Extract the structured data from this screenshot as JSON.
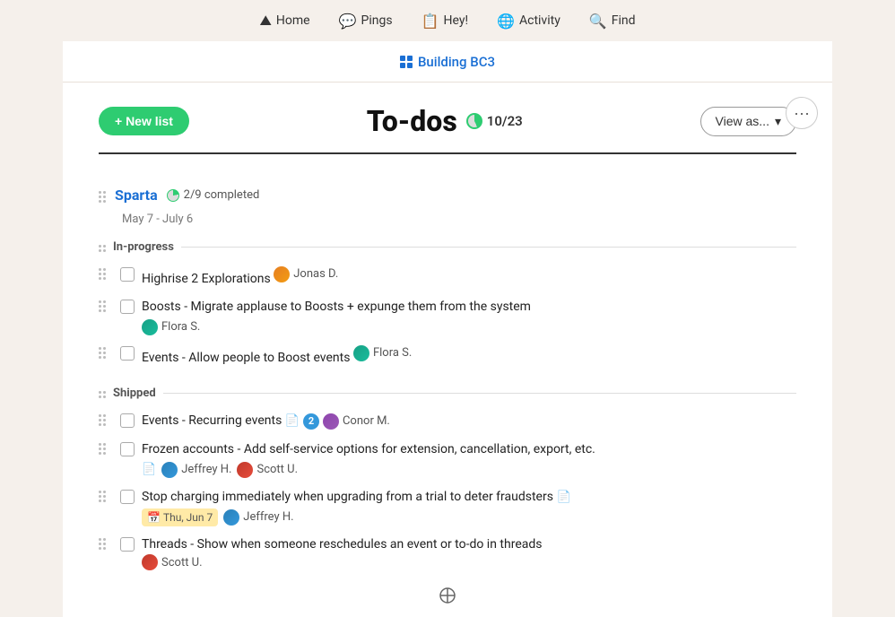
{
  "nav": {
    "items": [
      {
        "id": "home",
        "label": "Home",
        "icon": "⛰"
      },
      {
        "id": "pings",
        "label": "Pings",
        "icon": "💬"
      },
      {
        "id": "hey",
        "label": "Hey!",
        "icon": "📋"
      },
      {
        "id": "activity",
        "label": "Activity",
        "icon": "🌐"
      },
      {
        "id": "find",
        "label": "Find",
        "icon": "🔍"
      }
    ]
  },
  "breadcrumb": {
    "label": "Building BC3",
    "icon": "grid"
  },
  "page": {
    "new_list_label": "+ New list",
    "title": "To-dos",
    "progress_label": "10/23",
    "view_as_label": "View as...",
    "more_icon": "···"
  },
  "list": {
    "title": "Sparta",
    "progress": "2/9 completed",
    "date_range": "May 7 - July 6",
    "sections": [
      {
        "id": "in-progress",
        "label": "In-progress",
        "items": [
          {
            "id": 1,
            "text": "Highrise 2 Explorations",
            "assignee": "Jonas D.",
            "avatar_class": "avatar-jonas",
            "has_doc": false,
            "badge": null,
            "date": null,
            "second_assignee": null
          },
          {
            "id": 2,
            "text": "Boosts - Migrate applause to Boosts + expunge them from the system",
            "assignee": "Flora S.",
            "avatar_class": "avatar-flora",
            "has_doc": false,
            "badge": null,
            "date": null,
            "second_assignee": null
          },
          {
            "id": 3,
            "text": "Events - Allow people to Boost events",
            "assignee": "Flora S.",
            "avatar_class": "avatar-flora",
            "has_doc": false,
            "badge": null,
            "date": null,
            "second_assignee": null
          }
        ]
      },
      {
        "id": "shipped",
        "label": "Shipped",
        "items": [
          {
            "id": 4,
            "text": "Events - Recurring events",
            "assignee": "Conor M.",
            "avatar_class": "avatar-conor",
            "has_doc": true,
            "badge": "2",
            "date": null,
            "second_assignee": null
          },
          {
            "id": 5,
            "text": "Frozen accounts - Add self-service options for extension, cancellation, export, etc.",
            "assignee": "Jeffrey H.",
            "avatar_class": "avatar-jeffrey",
            "has_doc": true,
            "badge": null,
            "date": null,
            "second_assignee": "Scott U.",
            "second_avatar_class": "avatar-scott"
          },
          {
            "id": 6,
            "text": "Stop charging immediately when upgrading from a trial to deter fraudsters",
            "assignee": "Jeffrey H.",
            "avatar_class": "avatar-jeffrey",
            "has_doc": true,
            "badge": null,
            "date": "Thu, Jun 7",
            "second_assignee": null
          },
          {
            "id": 7,
            "text": "Threads - Show when someone reschedules an event or to-do in threads",
            "assignee": "Scott U.",
            "avatar_class": "avatar-scott",
            "has_doc": false,
            "badge": null,
            "date": null,
            "second_assignee": null
          }
        ]
      }
    ]
  }
}
